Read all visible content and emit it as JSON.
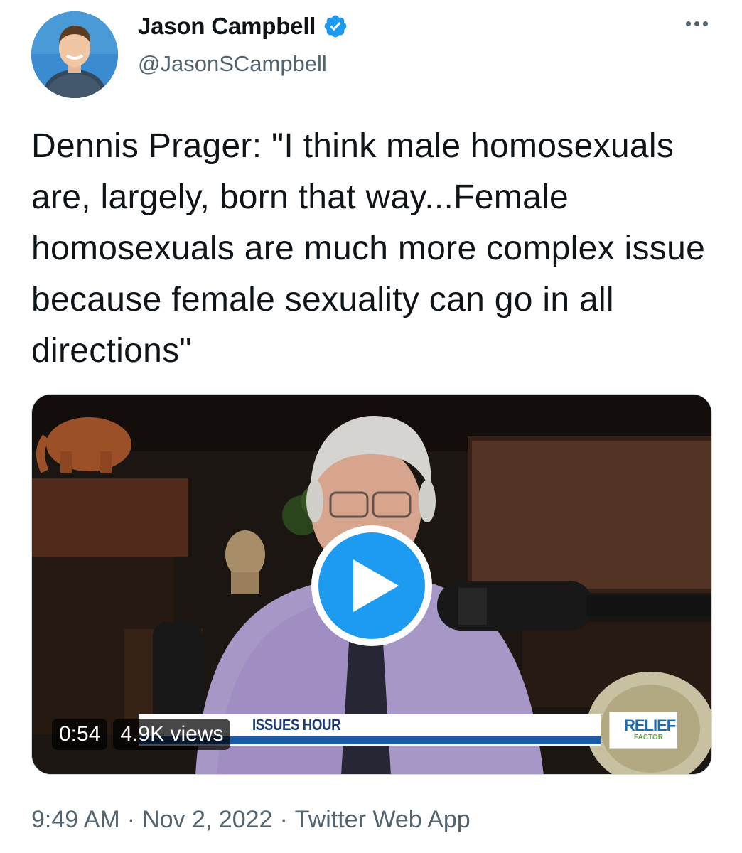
{
  "author": {
    "display_name": "Jason Campbell",
    "handle": "@JasonSCampbell",
    "verified": true,
    "avatar_icon": "profile-photo"
  },
  "tweet": {
    "text": "Dennis Prager: \"I think male homosexuals are, largely, born that way...Female homosexuals are much more complex issue because female sexuality can go in all directions\""
  },
  "media": {
    "type": "video",
    "duration": "0:54",
    "views": "4.9K views",
    "lower_third_title": "ISSUES HOUR",
    "sponsor_logo": "RELIEF",
    "sponsor_sub": "FACTOR",
    "play_icon": "play-icon"
  },
  "footer": {
    "time": "9:49 AM",
    "date": "Nov 2, 2022",
    "source": "Twitter Web App",
    "separator": "·"
  },
  "colors": {
    "accent": "#1d9bf0",
    "text_primary": "#0f1419",
    "text_secondary": "#536471"
  }
}
